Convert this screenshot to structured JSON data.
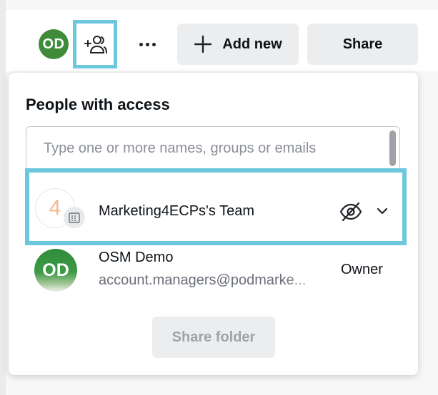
{
  "header": {
    "avatar_initials": "OD",
    "invite_icon": "add-people-icon",
    "more_icon": "more-dots-icon",
    "add_new_label": "Add new",
    "add_new_icon": "plus-icon",
    "share_label": "Share"
  },
  "panel": {
    "title": "People with access",
    "search": {
      "value": "",
      "placeholder": "Type one or more names, groups or emails"
    },
    "team": {
      "logo_text": "4",
      "badge_icon": "building-icon",
      "name": "Marketing4ECPs's Team",
      "visibility_icon": "eye-off-icon",
      "dropdown_icon": "chevron-down-icon"
    },
    "owner": {
      "avatar_initials": "OD",
      "name": "OSM Demo",
      "email": "account.managers@podmarke...",
      "role": "Owner"
    },
    "share_folder_label": "Share folder"
  },
  "colors": {
    "highlight": "#6cc9dd",
    "avatar_green": "#3f8b3a",
    "button_gray": "#ecedef",
    "disabled_text": "#a0a3a8"
  }
}
